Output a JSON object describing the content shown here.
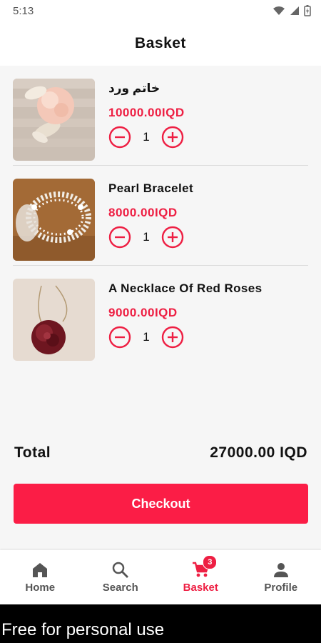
{
  "status_bar": {
    "time": "5:13"
  },
  "header": {
    "title": "Basket"
  },
  "items": [
    {
      "name": "خاتم ورد",
      "price": "10000.00IQD",
      "quantity": "1"
    },
    {
      "name": "Pearl Bracelet",
      "price": "8000.00IQD",
      "quantity": "1"
    },
    {
      "name": "A Necklace Of Red Roses",
      "price": "9000.00IQD",
      "quantity": "1"
    }
  ],
  "summary": {
    "total_label": "Total",
    "total_value": "27000.00 IQD"
  },
  "checkout": {
    "label": "Checkout"
  },
  "nav": {
    "home": "Home",
    "search": "Search",
    "basket": "Basket",
    "basket_badge": "3",
    "profile": "Profile"
  },
  "watermark": "Free for personal use",
  "colors": {
    "accent": "#ee1f43",
    "button": "#fb1d46"
  }
}
